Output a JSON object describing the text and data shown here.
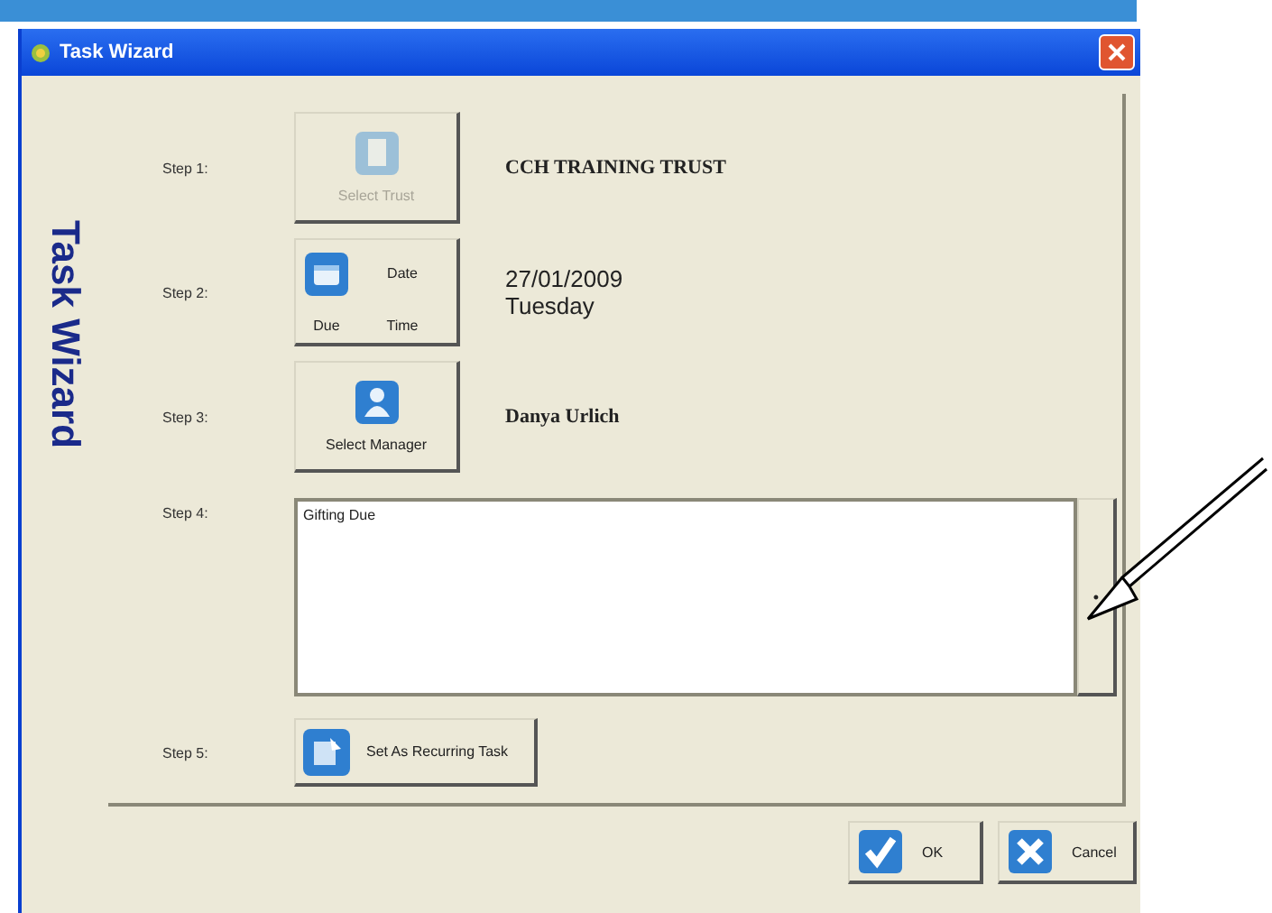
{
  "window": {
    "title": "Task Wizard"
  },
  "side_title": "Task Wizard",
  "steps": [
    {
      "label": "Step 1:",
      "kind": "pick",
      "button": {
        "label": "Select Trust",
        "disabled": true
      },
      "value": "CCH TRAINING TRUST"
    },
    {
      "label": "Step 2:",
      "kind": "date",
      "button": {
        "date": "Date",
        "due": "Due",
        "time": "Time",
        "disabled": false
      },
      "value_lines": [
        "27/01/2009",
        "Tuesday"
      ]
    },
    {
      "label": "Step 3:",
      "kind": "pick",
      "button": {
        "label": "Select Manager",
        "disabled": false
      },
      "value": "Danya Urlich"
    },
    {
      "label": "Step 4:",
      "kind": "notes",
      "text": "Gifting Due",
      "side_button": "•"
    },
    {
      "label": "Step 5:",
      "kind": "wide",
      "button": {
        "label": "Set As Recurring Task",
        "disabled": false
      }
    }
  ],
  "buttons": [
    {
      "label": "OK",
      "kind": "ok"
    },
    {
      "label": "Cancel",
      "kind": "cancel"
    }
  ]
}
